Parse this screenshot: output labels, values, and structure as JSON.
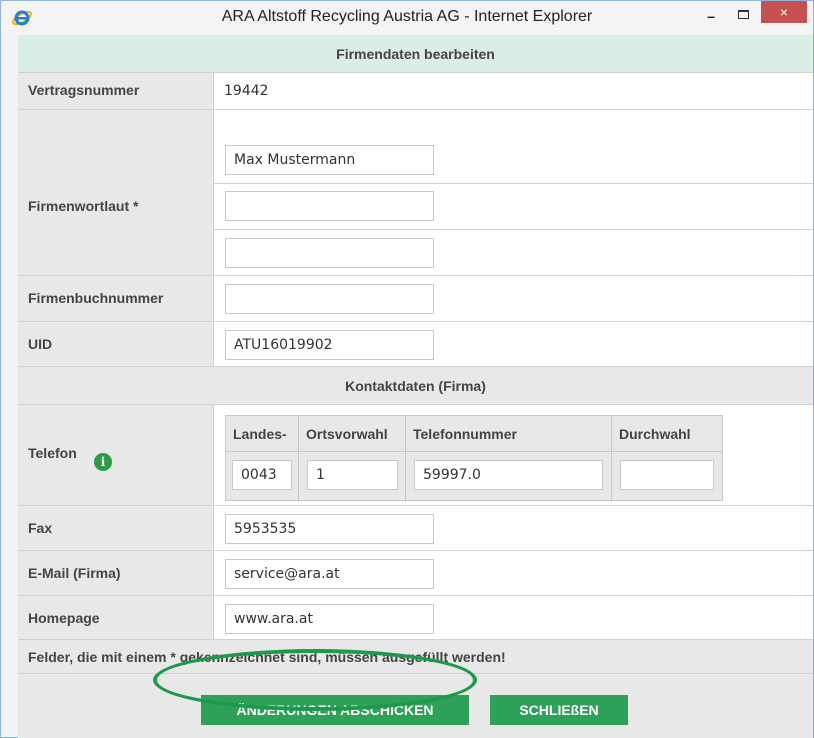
{
  "window": {
    "title": "ARA Altstoff Recycling Austria AG - Internet Explorer",
    "close_glyph": "×",
    "minimize_glyph": "–"
  },
  "form": {
    "header": "Firmendaten bearbeiten",
    "vertragsnummer": {
      "label": "Vertragsnummer",
      "value": "19442"
    },
    "firmenwortlaut": {
      "label": "Firmenwortlaut *",
      "values": [
        "Max Mustermann",
        "",
        ""
      ]
    },
    "firmenbuchnummer": {
      "label": "Firmenbuchnummer",
      "value": ""
    },
    "uid": {
      "label": "UID",
      "value": "ATU16019902"
    },
    "contact_header": "Kontaktdaten (Firma)",
    "telefon": {
      "label": "Telefon",
      "columns": [
        "Landes-",
        "Ortsvorwahl",
        "Telefonnummer",
        "Durchwahl"
      ],
      "values": [
        "0043",
        "1",
        "59997.0",
        ""
      ]
    },
    "fax": {
      "label": "Fax",
      "value": "5953535"
    },
    "email": {
      "label": "E-Mail (Firma)",
      "value": "service@ara.at"
    },
    "homepage": {
      "label": "Homepage",
      "value": "www.ara.at"
    },
    "required_note": "Felder, die mit einem * gekennzeichnet sind, müssen ausgefüllt werden!",
    "submit_label": "ÄNDERUNGEN ABSCHICKEN",
    "close_label": "SCHLIEßEN"
  },
  "colors": {
    "header_bg": "#d9efe5",
    "section_bg": "#e8e8e8",
    "button_green": "#2fa05a",
    "oval_green": "#1a9a4a",
    "close_red": "#c75050"
  },
  "icons": {
    "browser": "internet-explorer-icon",
    "info": "info-icon"
  }
}
